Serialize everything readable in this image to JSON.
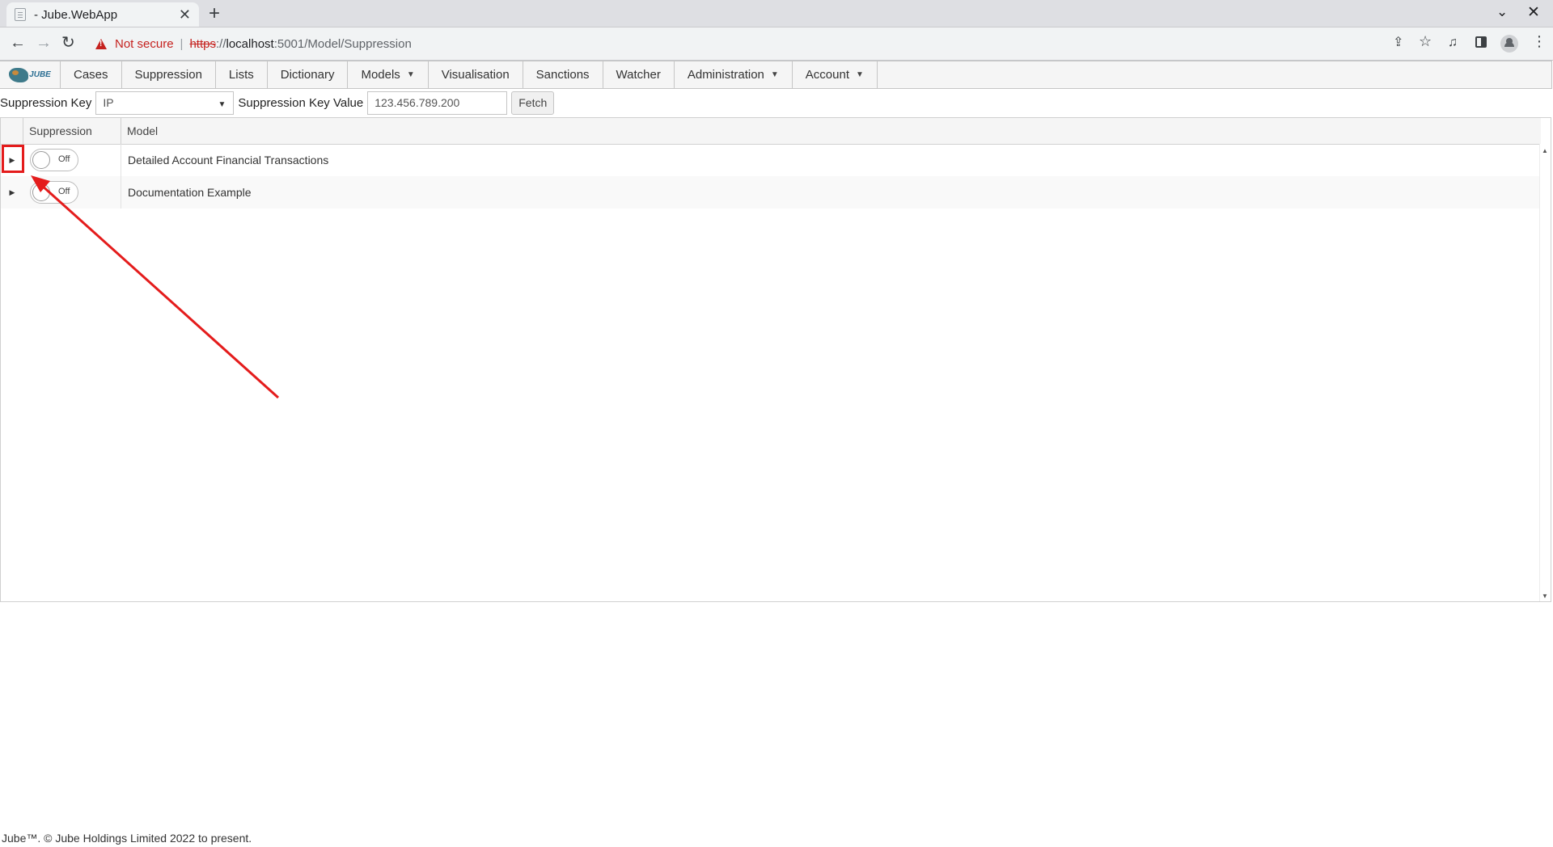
{
  "browser": {
    "tab_title": "- Jube.WebApp",
    "tab_close": "✕",
    "new_tab": "+",
    "security_label": "Not secure",
    "url_scheme": "https",
    "url_sep": "://",
    "url_host": "localhost",
    "url_path": ":5001/Model/Suppression"
  },
  "menu": {
    "logo_text": "JUBE",
    "items": [
      {
        "label": "Cases",
        "dropdown": false
      },
      {
        "label": "Suppression",
        "dropdown": false
      },
      {
        "label": "Lists",
        "dropdown": false
      },
      {
        "label": "Dictionary",
        "dropdown": false
      },
      {
        "label": "Models",
        "dropdown": true
      },
      {
        "label": "Visualisation",
        "dropdown": false
      },
      {
        "label": "Sanctions",
        "dropdown": false
      },
      {
        "label": "Watcher",
        "dropdown": false
      },
      {
        "label": "Administration",
        "dropdown": true
      },
      {
        "label": "Account",
        "dropdown": true
      }
    ]
  },
  "filters": {
    "key_label": "Suppression Key",
    "key_value": "IP",
    "value_label": "Suppression Key Value",
    "value_text": "123.456.789.200",
    "fetch_label": "Fetch"
  },
  "grid": {
    "columns": {
      "suppression": "Suppression",
      "model": "Model"
    },
    "rows": [
      {
        "toggle": "Off",
        "model": "Detailed Account Financial Transactions"
      },
      {
        "toggle": "Off",
        "model": "Documentation Example"
      }
    ]
  },
  "footer": {
    "text": "Jube™. © Jube Holdings Limited 2022 to present."
  },
  "colors": {
    "annotation": "#e41c1c",
    "not_secure": "#c5221f"
  }
}
